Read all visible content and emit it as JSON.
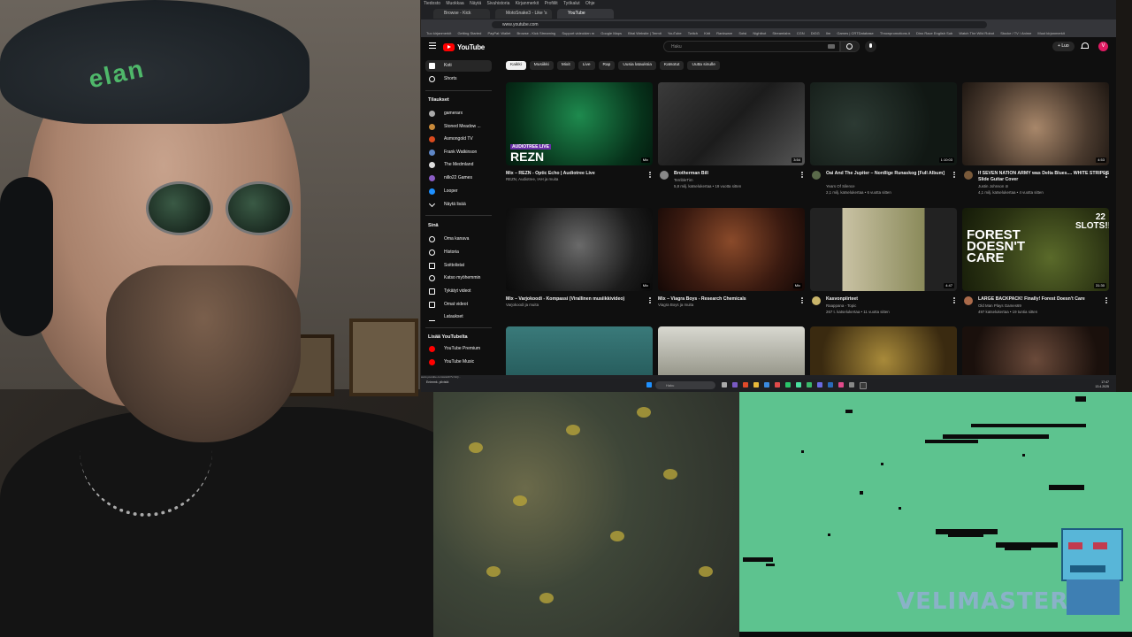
{
  "browser": {
    "menu_items": [
      "Tiedosto",
      "Muokkaa",
      "Näytä",
      "Sivuhistoria",
      "Kirjanmerkit",
      "Profiilit",
      "Työkalut",
      "Ohje"
    ],
    "tabs": [
      {
        "label": "Browse - Kick Streaming"
      },
      {
        "label": "MotoSnake3 - Like 's No Mu"
      },
      {
        "label": "YouTube",
        "active": true
      }
    ],
    "url": "www.youtube.com",
    "bookmarks": [
      "Tuo kirjanmerkit",
      "Getting Started",
      "PayPal: Wallet",
      "Browse - Kick Streaming",
      "Support videoiden m",
      "Google Maps",
      "Bhai Website | Termit",
      "YouTube",
      "Twitch",
      "Kirit",
      "Rankware",
      "Sotsi",
      "Nightbot",
      "Streamlabs",
      "CGN",
      "DiGG",
      "Ilm",
      "Games | CRTDatabase",
      "Throwpromotions.it",
      "Dino Race English Sub",
      "Watch The Wild Robot",
      "Stocke / TV / Anime",
      "Muut kirjanmerkit"
    ],
    "status_url": "www.youtube.com/watch?v=lxQ..."
  },
  "youtube": {
    "logo_text": "YouTube",
    "search_placeholder": "Haku",
    "create_label": "Luo",
    "avatar_letter": "V",
    "chips": [
      "Kaikki",
      "Musiikki",
      "Mixit",
      "Live",
      "Rap",
      "Uusia latauksia",
      "Katsotut",
      "Uutta sinulle"
    ],
    "sidebar": {
      "top": [
        {
          "label": "Koti",
          "active": true
        },
        {
          "label": "Shorts"
        }
      ],
      "subscriptions_title": "Tilaukset",
      "subscriptions": [
        {
          "label": "gamerarx",
          "color": "#aaaaaa"
        },
        {
          "label": "Stoned Meadow ...",
          "color": "#c98a3a"
        },
        {
          "label": "Asmongold TV",
          "color": "#d94a1e"
        },
        {
          "label": "Frank Watkinson",
          "color": "#5f87c7"
        },
        {
          "label": "The Medmland",
          "color": "#dddddd"
        },
        {
          "label": "nillo22 Games",
          "color": "#8a5cc4"
        },
        {
          "label": "Looper",
          "color": "#1e90ff"
        }
      ],
      "show_more": "Näytä lisää",
      "you_title": "Sinä",
      "you_items": [
        {
          "label": "Oma kanava"
        },
        {
          "label": "Historia"
        },
        {
          "label": "Soittolistat"
        },
        {
          "label": "Katso myöhemmin"
        },
        {
          "label": "Tykätyt videot"
        },
        {
          "label": "Omat videot"
        },
        {
          "label": "Lataukset"
        }
      ],
      "more_title": "Lisää YouTubelta",
      "more_items": [
        {
          "label": "YouTube Premium"
        },
        {
          "label": "YouTube Music"
        }
      ]
    },
    "videos": [
      {
        "title": "Mix – REZN - Optic Echo | Audiotree Live",
        "meta1": "REZN, Audiotree, IAH ja muita",
        "meta2": "",
        "duration": "Mix",
        "thumb_text": "REZN",
        "thumb_sub": "AUDIOTREE LIVE"
      },
      {
        "title": "Brotherman Bill",
        "meta1": "TerribleTim",
        "meta2": "5,8 milj. katselukertaa • 19 vuotta sitten",
        "duration": "3:54",
        "thumb_text": "",
        "thumb_sub": ""
      },
      {
        "title": "Oai And The Jupiter – Nordlige Runaskog [Full Album]",
        "meta1": "Years Of Silence",
        "meta2": "2,1 milj. katselukertaa • 6 vuotta sitten",
        "duration": "1:10:03",
        "thumb_text": "",
        "thumb_sub": ""
      },
      {
        "title": "If SEVEN NATION ARMY was Delta Blues.... WHITE STRIPES Slide Guitar Cover",
        "meta1": "Justin Johnson ⊘",
        "meta2": "4,1 milj. katselukertaa • 4 vuotta sitten",
        "duration": "4:53",
        "thumb_text": "",
        "thumb_sub": ""
      },
      {
        "title": "Mix – Varjokoodi - Kompassi (Virallinen musiikkivideo)",
        "meta1": "Varjokoodi ja muita",
        "meta2": "",
        "duration": "Mix",
        "thumb_text": "",
        "thumb_sub": ""
      },
      {
        "title": "Mix – Viagra Boys - Research Chemicals",
        "meta1": "Viagra Boys ja muita",
        "meta2": "",
        "duration": "Mix",
        "thumb_text": "",
        "thumb_sub": ""
      },
      {
        "title": "Kasvonpiirteet",
        "meta1": "Raappana - Topic",
        "meta2": "267 t. katselukertaa • 11 vuotta sitten",
        "duration": "4:47",
        "thumb_text": "",
        "thumb_sub": ""
      },
      {
        "title": "LARGE BACKPACK! Finally! Forest Doesn't Care",
        "meta1": "Old Man Plays Games69",
        "meta2": "497 katselukertaa • 19 tuntia sitten",
        "duration": "31:30",
        "thumb_text": "FOREST DOESN'T CARE",
        "thumb_sub": "22 SLOTS!!"
      }
    ]
  },
  "taskbar": {
    "search_label": "Haku",
    "weather": "Enimmk. pilvistä",
    "clock_time": "17:47",
    "clock_date": "13.4.2025"
  },
  "overlay": {
    "game_logo": "VELIMASTER"
  }
}
